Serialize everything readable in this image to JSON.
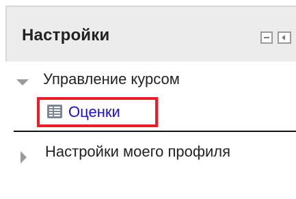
{
  "block": {
    "title": "Настройки",
    "controls": {
      "minimize_icon": "minus-box-icon",
      "dock_icon": "dock-left-icon"
    }
  },
  "tree": {
    "course_admin": {
      "label": "Управление курсом",
      "expanded": true
    },
    "grades": {
      "label": "Оценки",
      "icon": "grades-table-icon",
      "highlight_color": "#ee1c25",
      "link_color": "#1a0dd8"
    },
    "profile_settings": {
      "label": "Настройки моего профиля",
      "expanded": false
    }
  }
}
